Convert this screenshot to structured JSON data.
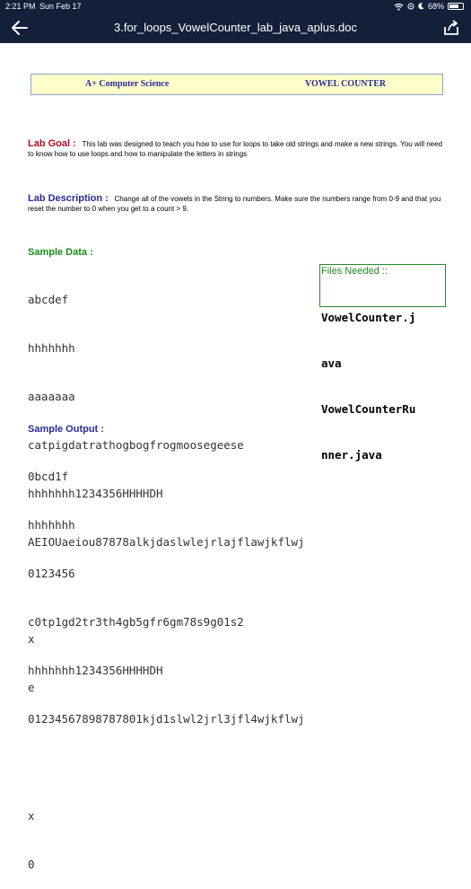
{
  "status_bar": {
    "time": "2:21 PM",
    "date": "Sun Feb 17",
    "battery": "68%"
  },
  "nav": {
    "title": "3.for_loops_VowelCounter_lab_java_aplus.doc"
  },
  "header": {
    "left": "A+ Computer Science",
    "right": "VOWEL COUNTER"
  },
  "lab_goal": {
    "label": "Lab Goal :",
    "text": "This lab was designed to teach you how to use for loops to take old strings and make a new strings.  You will need to know how to use loops and how to manipulate the letters in strings"
  },
  "lab_description": {
    "label": "Lab Description :",
    "text": "Change all of the vowels in the String to numbers.  Make sure the numbers range from 0-9 and that you reset the number to 0 when you get to a count > 9."
  },
  "sample_data": {
    "label": "Sample Data :",
    "lines": [
      "abcdef",
      "hhhhhhh",
      "aaaaaaa",
      "catpigdatrathogbogfrogmoosegeese",
      "hhhhhhh1234356HHHHDH",
      "AEIOUaeiou87878alkjdaslwlejrlajflawjkflwj",
      "",
      "x",
      "e"
    ]
  },
  "files_needed": {
    "label": "Files Needed ::",
    "lines": [
      "VowelCounter.j",
      "ava",
      "VowelCounterRu",
      "nner.java"
    ]
  },
  "sample_output": {
    "label": "Sample Output :",
    "lines": [
      "0bcd1f",
      "hhhhhhh",
      "0123456",
      "c0tp1gd2tr3th4gb5gfr6gm78s9g01s2",
      "hhhhhhh1234356HHHHDH",
      "01234567898787801kjd1slwl2jrl3jfl4wjkflwj",
      "",
      "x",
      "0"
    ]
  },
  "colors": {
    "navbar": "#13203a",
    "header_fill": "#ffffcc",
    "goal_label": "#b01020",
    "desc_label": "#2a2a9a",
    "green_label": "#1a8a1a"
  },
  "icons": {
    "back": "arrow-left-icon",
    "share": "share-icon",
    "wifi": "wifi-icon",
    "battery": "battery-icon"
  }
}
